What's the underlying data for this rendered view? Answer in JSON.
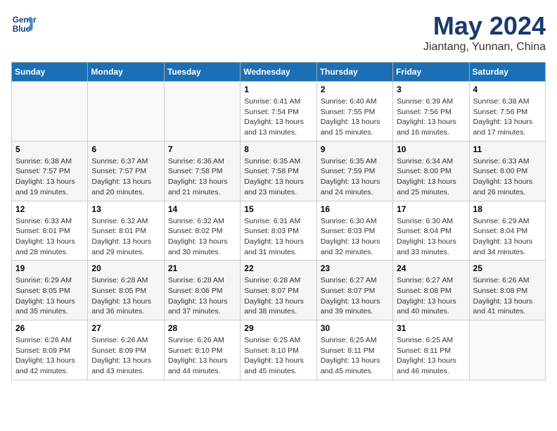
{
  "header": {
    "logo_line1": "General",
    "logo_line2": "Blue",
    "month": "May 2024",
    "location": "Jiantang, Yunnan, China"
  },
  "weekdays": [
    "Sunday",
    "Monday",
    "Tuesday",
    "Wednesday",
    "Thursday",
    "Friday",
    "Saturday"
  ],
  "weeks": [
    [
      {
        "day": "",
        "info": ""
      },
      {
        "day": "",
        "info": ""
      },
      {
        "day": "",
        "info": ""
      },
      {
        "day": "1",
        "info": "Sunrise: 6:41 AM\nSunset: 7:54 PM\nDaylight: 13 hours\nand 13 minutes."
      },
      {
        "day": "2",
        "info": "Sunrise: 6:40 AM\nSunset: 7:55 PM\nDaylight: 13 hours\nand 15 minutes."
      },
      {
        "day": "3",
        "info": "Sunrise: 6:39 AM\nSunset: 7:56 PM\nDaylight: 13 hours\nand 16 minutes."
      },
      {
        "day": "4",
        "info": "Sunrise: 6:38 AM\nSunset: 7:56 PM\nDaylight: 13 hours\nand 17 minutes."
      }
    ],
    [
      {
        "day": "5",
        "info": "Sunrise: 6:38 AM\nSunset: 7:57 PM\nDaylight: 13 hours\nand 19 minutes."
      },
      {
        "day": "6",
        "info": "Sunrise: 6:37 AM\nSunset: 7:57 PM\nDaylight: 13 hours\nand 20 minutes."
      },
      {
        "day": "7",
        "info": "Sunrise: 6:36 AM\nSunset: 7:58 PM\nDaylight: 13 hours\nand 21 minutes."
      },
      {
        "day": "8",
        "info": "Sunrise: 6:35 AM\nSunset: 7:58 PM\nDaylight: 13 hours\nand 23 minutes."
      },
      {
        "day": "9",
        "info": "Sunrise: 6:35 AM\nSunset: 7:59 PM\nDaylight: 13 hours\nand 24 minutes."
      },
      {
        "day": "10",
        "info": "Sunrise: 6:34 AM\nSunset: 8:00 PM\nDaylight: 13 hours\nand 25 minutes."
      },
      {
        "day": "11",
        "info": "Sunrise: 6:33 AM\nSunset: 8:00 PM\nDaylight: 13 hours\nand 26 minutes."
      }
    ],
    [
      {
        "day": "12",
        "info": "Sunrise: 6:33 AM\nSunset: 8:01 PM\nDaylight: 13 hours\nand 28 minutes."
      },
      {
        "day": "13",
        "info": "Sunrise: 6:32 AM\nSunset: 8:01 PM\nDaylight: 13 hours\nand 29 minutes."
      },
      {
        "day": "14",
        "info": "Sunrise: 6:32 AM\nSunset: 8:02 PM\nDaylight: 13 hours\nand 30 minutes."
      },
      {
        "day": "15",
        "info": "Sunrise: 6:31 AM\nSunset: 8:03 PM\nDaylight: 13 hours\nand 31 minutes."
      },
      {
        "day": "16",
        "info": "Sunrise: 6:30 AM\nSunset: 8:03 PM\nDaylight: 13 hours\nand 32 minutes."
      },
      {
        "day": "17",
        "info": "Sunrise: 6:30 AM\nSunset: 8:04 PM\nDaylight: 13 hours\nand 33 minutes."
      },
      {
        "day": "18",
        "info": "Sunrise: 6:29 AM\nSunset: 8:04 PM\nDaylight: 13 hours\nand 34 minutes."
      }
    ],
    [
      {
        "day": "19",
        "info": "Sunrise: 6:29 AM\nSunset: 8:05 PM\nDaylight: 13 hours\nand 35 minutes."
      },
      {
        "day": "20",
        "info": "Sunrise: 6:28 AM\nSunset: 8:05 PM\nDaylight: 13 hours\nand 36 minutes."
      },
      {
        "day": "21",
        "info": "Sunrise: 6:28 AM\nSunset: 8:06 PM\nDaylight: 13 hours\nand 37 minutes."
      },
      {
        "day": "22",
        "info": "Sunrise: 6:28 AM\nSunset: 8:07 PM\nDaylight: 13 hours\nand 38 minutes."
      },
      {
        "day": "23",
        "info": "Sunrise: 6:27 AM\nSunset: 8:07 PM\nDaylight: 13 hours\nand 39 minutes."
      },
      {
        "day": "24",
        "info": "Sunrise: 6:27 AM\nSunset: 8:08 PM\nDaylight: 13 hours\nand 40 minutes."
      },
      {
        "day": "25",
        "info": "Sunrise: 6:26 AM\nSunset: 8:08 PM\nDaylight: 13 hours\nand 41 minutes."
      }
    ],
    [
      {
        "day": "26",
        "info": "Sunrise: 6:26 AM\nSunset: 8:09 PM\nDaylight: 13 hours\nand 42 minutes."
      },
      {
        "day": "27",
        "info": "Sunrise: 6:26 AM\nSunset: 8:09 PM\nDaylight: 13 hours\nand 43 minutes."
      },
      {
        "day": "28",
        "info": "Sunrise: 6:26 AM\nSunset: 8:10 PM\nDaylight: 13 hours\nand 44 minutes."
      },
      {
        "day": "29",
        "info": "Sunrise: 6:25 AM\nSunset: 8:10 PM\nDaylight: 13 hours\nand 45 minutes."
      },
      {
        "day": "30",
        "info": "Sunrise: 6:25 AM\nSunset: 8:11 PM\nDaylight: 13 hours\nand 45 minutes."
      },
      {
        "day": "31",
        "info": "Sunrise: 6:25 AM\nSunset: 8:11 PM\nDaylight: 13 hours\nand 46 minutes."
      },
      {
        "day": "",
        "info": ""
      }
    ]
  ]
}
